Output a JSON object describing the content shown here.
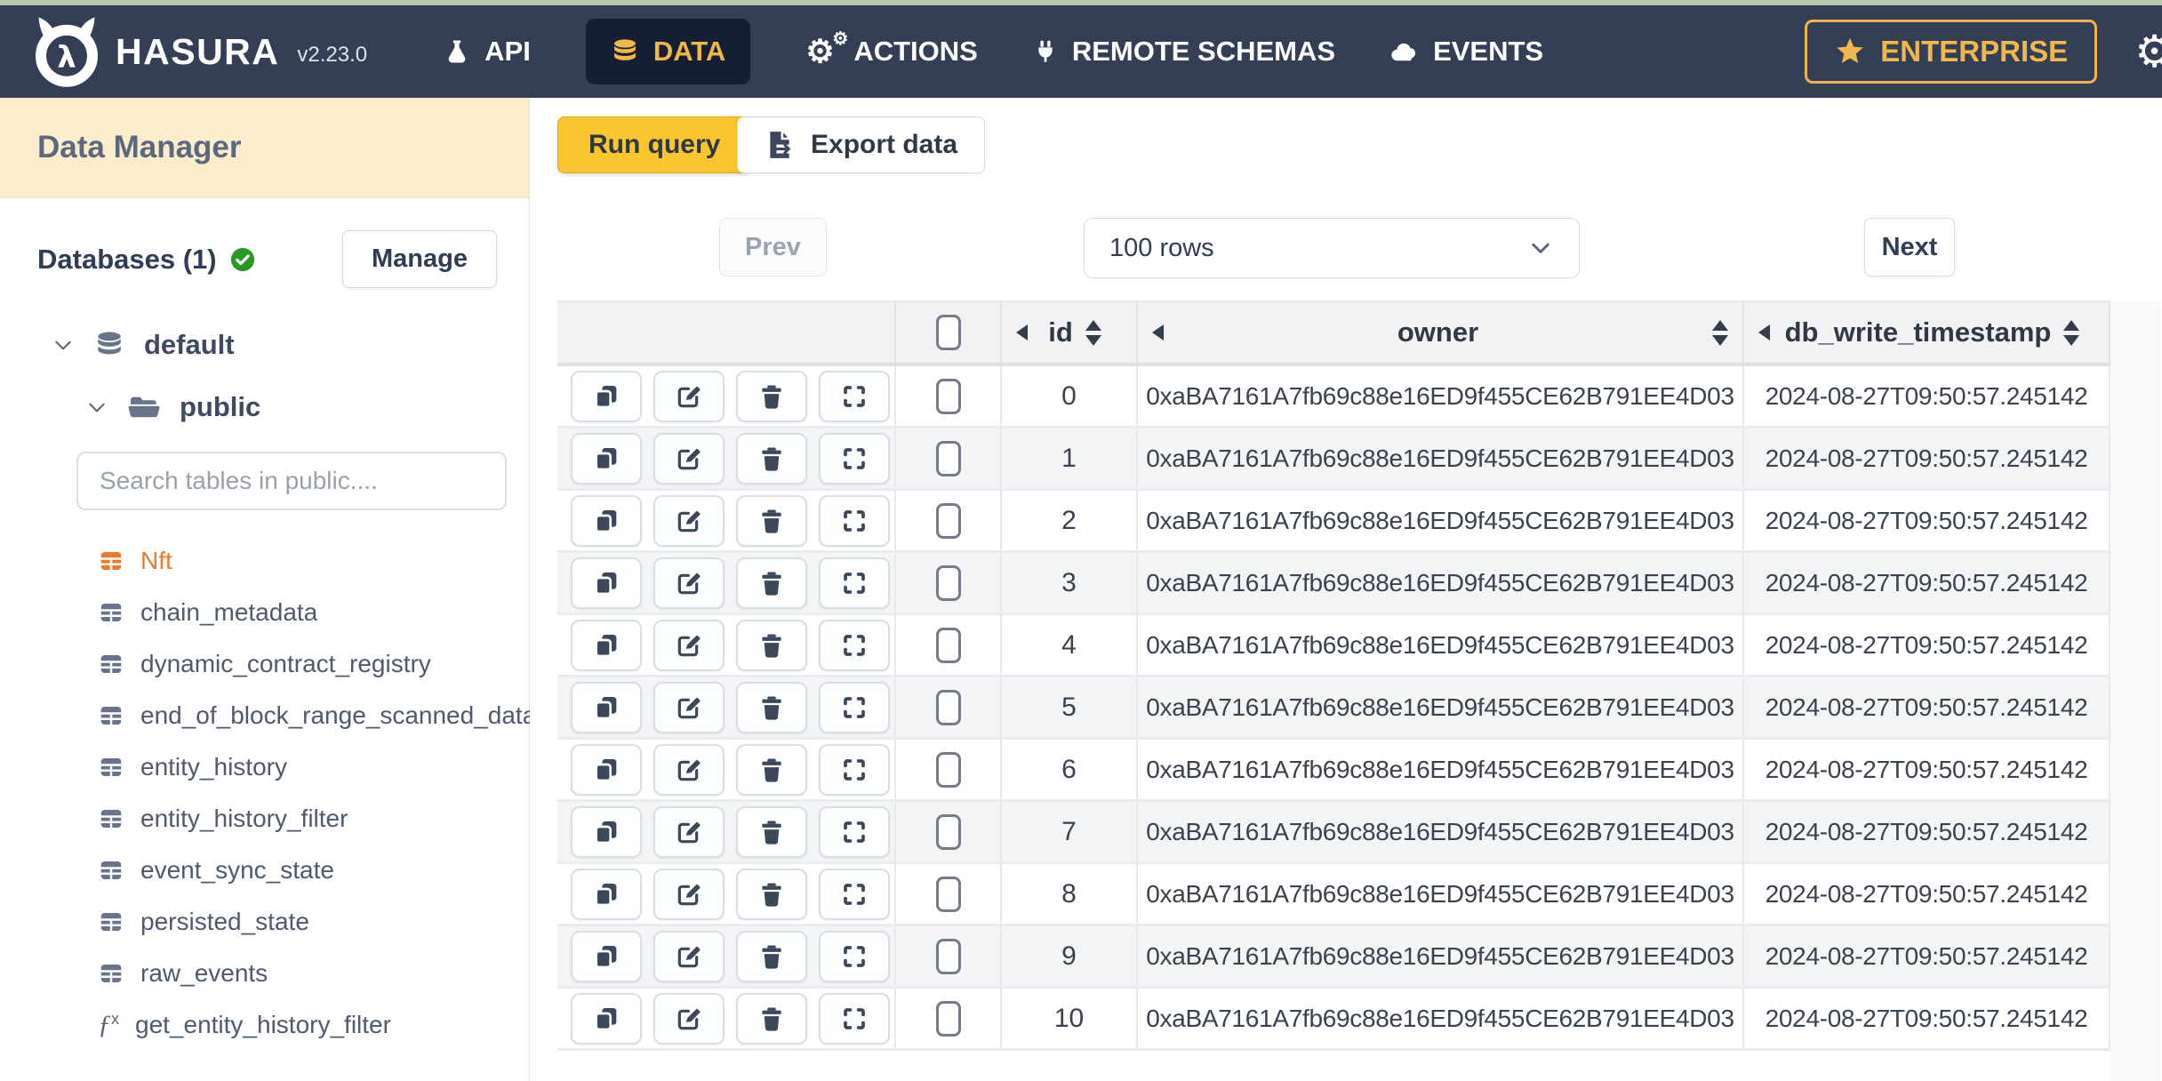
{
  "nav": {
    "brand": "HASURA",
    "version": "v2.23.0",
    "items": [
      {
        "label": "API",
        "icon": "flask-icon",
        "active": false
      },
      {
        "label": "DATA",
        "icon": "database-icon",
        "active": true
      },
      {
        "label": "ACTIONS",
        "icon": "gears-icon",
        "active": false
      },
      {
        "label": "REMOTE SCHEMAS",
        "icon": "plug-icon",
        "active": false
      },
      {
        "label": "EVENTS",
        "icon": "cloud-icon",
        "active": false
      }
    ],
    "enterprise_label": "ENTERPRISE"
  },
  "sidebar": {
    "title": "Data Manager",
    "databases_label": "Databases (1)",
    "manage_label": "Manage",
    "tree": {
      "database": "default",
      "schema": "public"
    },
    "search_placeholder": "Search tables in public....",
    "tables": [
      {
        "name": "Nft",
        "type": "table",
        "active": true
      },
      {
        "name": "chain_metadata",
        "type": "table",
        "active": false
      },
      {
        "name": "dynamic_contract_registry",
        "type": "table",
        "active": false
      },
      {
        "name": "end_of_block_range_scanned_data",
        "type": "table",
        "active": false
      },
      {
        "name": "entity_history",
        "type": "table",
        "active": false
      },
      {
        "name": "entity_history_filter",
        "type": "table",
        "active": false
      },
      {
        "name": "event_sync_state",
        "type": "table",
        "active": false
      },
      {
        "name": "persisted_state",
        "type": "table",
        "active": false
      },
      {
        "name": "raw_events",
        "type": "table",
        "active": false
      },
      {
        "name": "get_entity_history_filter",
        "type": "function",
        "active": false
      }
    ]
  },
  "toolbar": {
    "run_query_label": "Run query",
    "export_data_label": "Export data"
  },
  "pagination": {
    "prev_label": "Prev",
    "rows_selected": "100 rows",
    "next_label": "Next"
  },
  "data_table": {
    "columns": [
      "id",
      "owner",
      "db_write_timestamp"
    ],
    "rows": [
      {
        "id": "0",
        "owner": "0xaBA7161A7fb69c88e16ED9f455CE62B791EE4D03",
        "db_write_timestamp": "2024-08-27T09:50:57.245142"
      },
      {
        "id": "1",
        "owner": "0xaBA7161A7fb69c88e16ED9f455CE62B791EE4D03",
        "db_write_timestamp": "2024-08-27T09:50:57.245142"
      },
      {
        "id": "2",
        "owner": "0xaBA7161A7fb69c88e16ED9f455CE62B791EE4D03",
        "db_write_timestamp": "2024-08-27T09:50:57.245142"
      },
      {
        "id": "3",
        "owner": "0xaBA7161A7fb69c88e16ED9f455CE62B791EE4D03",
        "db_write_timestamp": "2024-08-27T09:50:57.245142"
      },
      {
        "id": "4",
        "owner": "0xaBA7161A7fb69c88e16ED9f455CE62B791EE4D03",
        "db_write_timestamp": "2024-08-27T09:50:57.245142"
      },
      {
        "id": "5",
        "owner": "0xaBA7161A7fb69c88e16ED9f455CE62B791EE4D03",
        "db_write_timestamp": "2024-08-27T09:50:57.245142"
      },
      {
        "id": "6",
        "owner": "0xaBA7161A7fb69c88e16ED9f455CE62B791EE4D03",
        "db_write_timestamp": "2024-08-27T09:50:57.245142"
      },
      {
        "id": "7",
        "owner": "0xaBA7161A7fb69c88e16ED9f455CE62B791EE4D03",
        "db_write_timestamp": "2024-08-27T09:50:57.245142"
      },
      {
        "id": "8",
        "owner": "0xaBA7161A7fb69c88e16ED9f455CE62B791EE4D03",
        "db_write_timestamp": "2024-08-27T09:50:57.245142"
      },
      {
        "id": "9",
        "owner": "0xaBA7161A7fb69c88e16ED9f455CE62B791EE4D03",
        "db_write_timestamp": "2024-08-27T09:50:57.245142"
      },
      {
        "id": "10",
        "owner": "0xaBA7161A7fb69c88e16ED9f455CE62B791EE4D03",
        "db_write_timestamp": "2024-08-27T09:50:57.245142"
      }
    ]
  },
  "colors": {
    "top_strip": "#B5C9AE",
    "nav_bg": "#343F55",
    "active_tab_bg": "#161F31",
    "brand_gold": "#EFB74C",
    "run_query_yellow": "#FBC52F",
    "sidebar_header_cream": "#FBEDCB",
    "active_table_orange": "#ED7A2B",
    "connected_green": "#2D9726",
    "header_gray": "#F2F2F4",
    "row_stripe_gray": "#F3F4F6",
    "icon_slate": "#3C4859"
  }
}
